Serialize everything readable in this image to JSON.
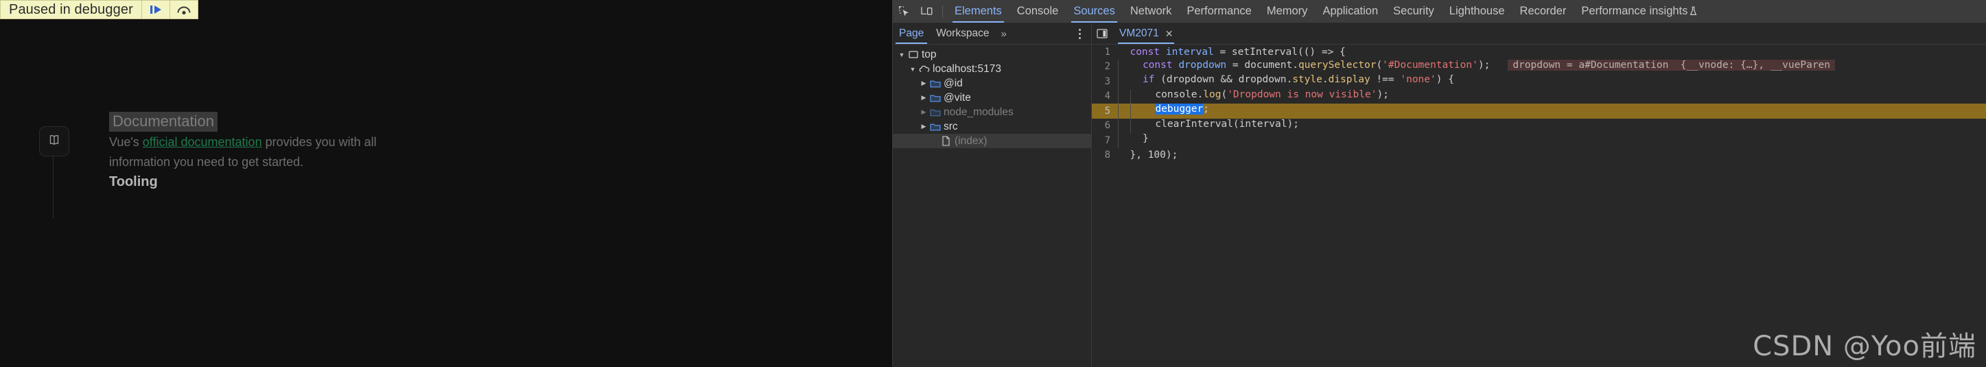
{
  "banner": {
    "text": "Paused in debugger",
    "resume_icon": "resume-script-icon",
    "step-over_icon": "step-over-icon"
  },
  "page": {
    "book_icon": "book-icon",
    "heading": "Documentation",
    "paragraph_before": "Vue's ",
    "paragraph_link": "official documentation",
    "paragraph_after": " provides you with all information you need to get started.",
    "tooling_heading": "Tooling"
  },
  "devtools": {
    "inspect_icon": "inspect-element-icon",
    "device_icon": "device-toolbar-icon",
    "tabs": [
      {
        "label": "Elements",
        "selected": false
      },
      {
        "label": "Console",
        "selected": false
      },
      {
        "label": "Sources",
        "selected": true
      },
      {
        "label": "Network",
        "selected": false
      },
      {
        "label": "Performance",
        "selected": false
      },
      {
        "label": "Memory",
        "selected": false
      },
      {
        "label": "Application",
        "selected": false
      },
      {
        "label": "Security",
        "selected": false
      },
      {
        "label": "Lighthouse",
        "selected": false
      },
      {
        "label": "Recorder",
        "selected": false
      },
      {
        "label": "Performance insights",
        "selected": false
      }
    ],
    "tab_warning_icon": "warning-beaker-icon",
    "accent_color": "#8ab4f8",
    "navigator": {
      "tabs": [
        {
          "label": "Page",
          "selected": true
        },
        {
          "label": "Workspace",
          "selected": false
        }
      ],
      "more_label": "»",
      "kebab_icon": "more-options-icon",
      "tree": [
        {
          "label": "top",
          "icon": "frame-icon",
          "depth": 0,
          "twisty": "▼",
          "dim": false,
          "selected": false
        },
        {
          "label": "localhost:5173",
          "icon": "cloud-icon",
          "depth": 1,
          "twisty": "▼",
          "dim": false,
          "selected": false
        },
        {
          "label": "@id",
          "icon": "folder-icon",
          "depth": 2,
          "twisty": "▶",
          "dim": false,
          "selected": false
        },
        {
          "label": "@vite",
          "icon": "folder-icon",
          "depth": 2,
          "twisty": "▶",
          "dim": false,
          "selected": false
        },
        {
          "label": "node_modules",
          "icon": "folder-icon",
          "depth": 2,
          "twisty": "▶",
          "dim": true,
          "selected": false
        },
        {
          "label": "src",
          "icon": "folder-icon",
          "depth": 2,
          "twisty": "▶",
          "dim": false,
          "selected": false
        },
        {
          "label": "(index)",
          "icon": "document-icon",
          "depth": 3,
          "twisty": "",
          "dim": true,
          "selected": true
        }
      ]
    },
    "editor": {
      "panel_toggle_icon": "show-navigator-icon",
      "file_tab": "VM2071",
      "file_tab_close_icon": "close-icon",
      "lines": [
        {
          "n": "1",
          "highlight": false
        },
        {
          "n": "2",
          "highlight": false
        },
        {
          "n": "3",
          "highlight": false
        },
        {
          "n": "4",
          "highlight": false
        },
        {
          "n": "5",
          "highlight": true
        },
        {
          "n": "6",
          "highlight": false
        },
        {
          "n": "7",
          "highlight": false
        },
        {
          "n": "8",
          "highlight": false
        }
      ],
      "code": {
        "l1_kw": "const",
        "l1_var": " interval ",
        "l1_rest": "= setInterval(() => {",
        "l2_kw": "const",
        "l2_var": " dropdown ",
        "l2_eq": "= document.",
        "l2_fn": "querySelector",
        "l2_open": "(",
        "l2_str": "'#Documentation'",
        "l2_close": ");",
        "l2_inline": "dropdown = a#Documentation  {__vnode: {…}, __vueParen",
        "l3_kw": "if",
        "l3_a": " (dropdown && dropdown.",
        "l3_prop": "style",
        "l3_b": ".",
        "l3_prop2": "display",
        "l3_c": " !== ",
        "l3_str": "'none'",
        "l3_d": ") {",
        "l4_a": "console.",
        "l4_fn": "log",
        "l4_open": "(",
        "l4_str": "'Dropdown is now visible'",
        "l4_close": ");",
        "l5_dbg": "debugger",
        "l5_semi": ";",
        "l6": "clearInterval(interval);",
        "l7": "}",
        "l8": "}, 100);"
      }
    }
  },
  "watermark": "CSDN @Yoo前端"
}
